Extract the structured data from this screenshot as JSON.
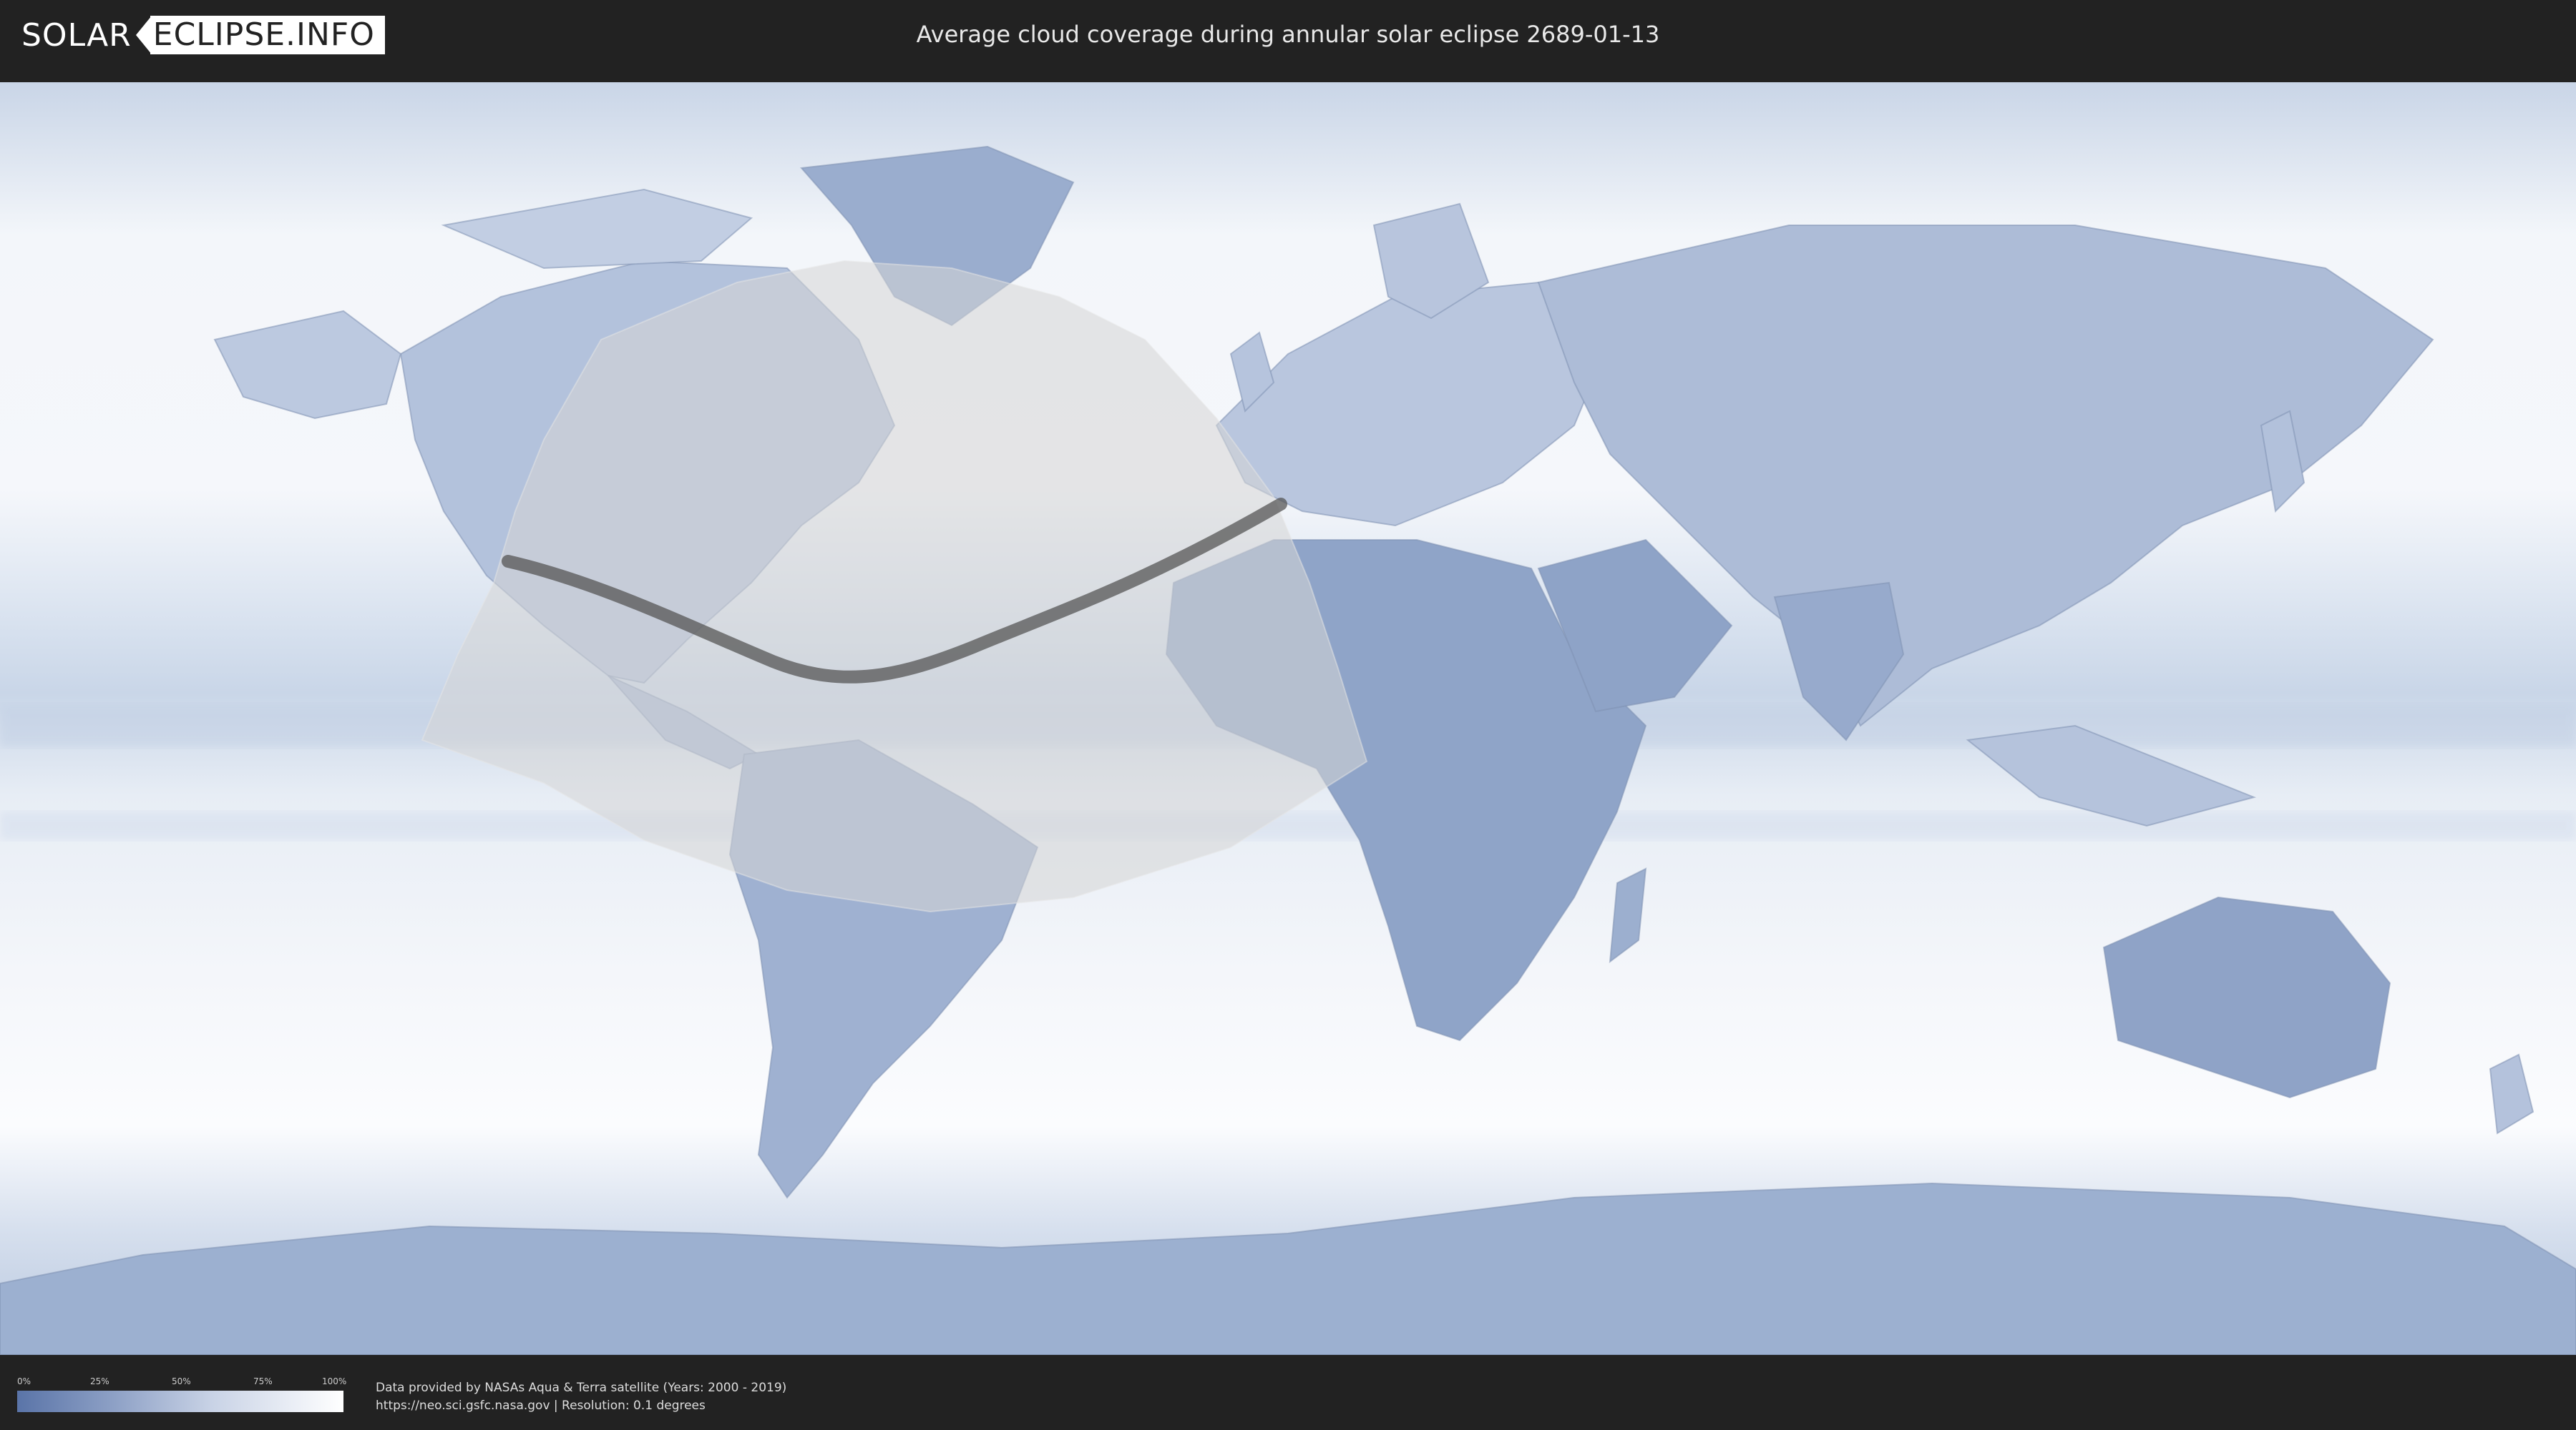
{
  "header": {
    "logo_part1": "SOLAR",
    "logo_part2": "ECLIPSE.INFO",
    "title": "Average cloud coverage during annular solar eclipse 2689-01-13"
  },
  "legend": {
    "ticks": [
      "0%",
      "25%",
      "50%",
      "75%",
      "100%"
    ],
    "colors": {
      "low": "#5a74a8",
      "mid": "#8ea1c6",
      "high": "#ffffff"
    }
  },
  "credits": {
    "line1": "Data provided by NASAs Aqua & Terra satellite (Years: 2000 - 2019)",
    "line2": "https://neo.sci.gsfc.nasa.gov | Resolution: 0.1 degrees"
  },
  "map": {
    "ocean_color": "#eef2f8",
    "land_color": "#9fb2d1",
    "overlay_color": "#cfcfcf",
    "path_color": "#555555"
  }
}
